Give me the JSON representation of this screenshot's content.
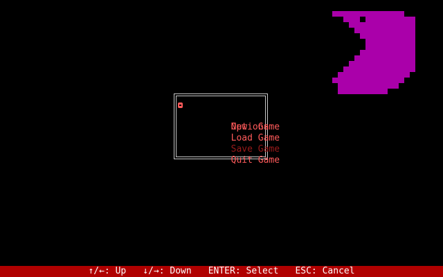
{
  "colors": {
    "background": "#000000",
    "creature": "#aa00aa",
    "menu_text": "#ff5a5a",
    "menu_text_disabled": "#9a1a1a",
    "menu_border": "#c8c8c8",
    "statusbar_bg": "#b00000",
    "statusbar_text": "#ffffff"
  },
  "creature": {
    "icon": "pacman-creature-icon"
  },
  "menu": {
    "cursor_icon": "bullet-cursor-icon",
    "selected_index": 0,
    "items": [
      {
        "label": "New  Game",
        "enabled": true
      },
      {
        "label": "Options",
        "enabled": true
      },
      {
        "label": "Load Game",
        "enabled": true
      },
      {
        "label": "Save Game",
        "enabled": false
      },
      {
        "label": "Quit Game",
        "enabled": true
      }
    ]
  },
  "statusbar": {
    "hints": [
      "↑/←: Up",
      "↓/→: Down",
      "ENTER: Select",
      "ESC: Cancel"
    ]
  }
}
